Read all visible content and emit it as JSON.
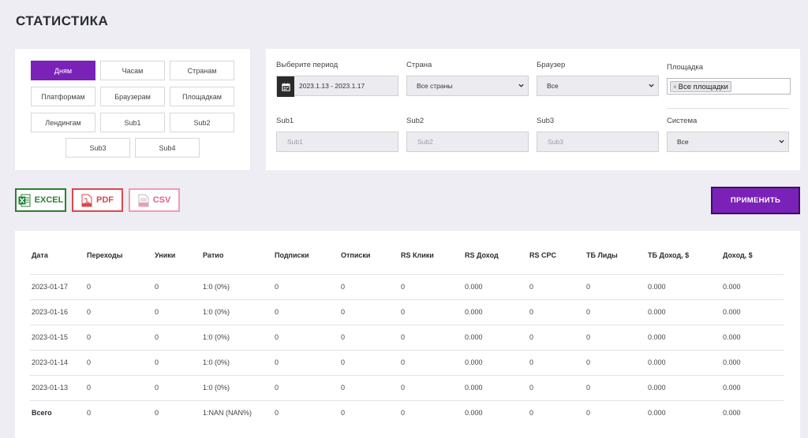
{
  "page": {
    "title": "СТАТИСТИКА"
  },
  "groupby": {
    "buttons": [
      "Дням",
      "Часам",
      "Странам",
      "Платформам",
      "Браузерам",
      "Площадкам",
      "Лендингам",
      "Sub1",
      "Sub2",
      "Sub3",
      "Sub4"
    ],
    "active": "Дням"
  },
  "filters": {
    "period_label": "Выберите период",
    "period_value": "2023.1.13 - 2023.1.17",
    "country_label": "Страна",
    "country_value": "Все страны",
    "browser_label": "Браузер",
    "browser_value": "Все",
    "site_label": "Площадка",
    "site_tag": "Все площадки",
    "sub1_label": "Sub1",
    "sub1_placeholder": "Sub1",
    "sub2_label": "Sub2",
    "sub2_placeholder": "Sub2",
    "sub3_label": "Sub3",
    "sub3_placeholder": "Sub3",
    "system_label": "Система",
    "system_value": "Все"
  },
  "exports": {
    "excel": "EXCEL",
    "pdf": "PDF",
    "csv": "CSV"
  },
  "apply_label": "ПРИМЕНИТЬ",
  "table": {
    "headers": [
      "Дата",
      "Переходы",
      "Уники",
      "Ратио",
      "Подписки",
      "Отписки",
      "RS Клики",
      "RS Доход",
      "RS CPC",
      "ТБ Лиды",
      "ТБ Доход, $",
      "Доход, $"
    ],
    "rows": [
      [
        "2023-01-17",
        "0",
        "0",
        "1:0 (0%)",
        "0",
        "0",
        "0",
        "0.000",
        "0",
        "0",
        "0.000",
        "0.000"
      ],
      [
        "2023-01-16",
        "0",
        "0",
        "1:0 (0%)",
        "0",
        "0",
        "0",
        "0.000",
        "0",
        "0",
        "0.000",
        "0.000"
      ],
      [
        "2023-01-15",
        "0",
        "0",
        "1:0 (0%)",
        "0",
        "0",
        "0",
        "0.000",
        "0",
        "0",
        "0.000",
        "0.000"
      ],
      [
        "2023-01-14",
        "0",
        "0",
        "1:0 (0%)",
        "0",
        "0",
        "0",
        "0.000",
        "0",
        "0",
        "0.000",
        "0.000"
      ],
      [
        "2023-01-13",
        "0",
        "0",
        "1:0 (0%)",
        "0",
        "0",
        "0",
        "0.000",
        "0",
        "0",
        "0.000",
        "0.000"
      ]
    ],
    "total": [
      "Всего",
      "0",
      "0",
      "1:NAN (NAN%)",
      "0",
      "0",
      "0",
      "0.000",
      "0",
      "0",
      "0.000",
      "0.000"
    ]
  }
}
